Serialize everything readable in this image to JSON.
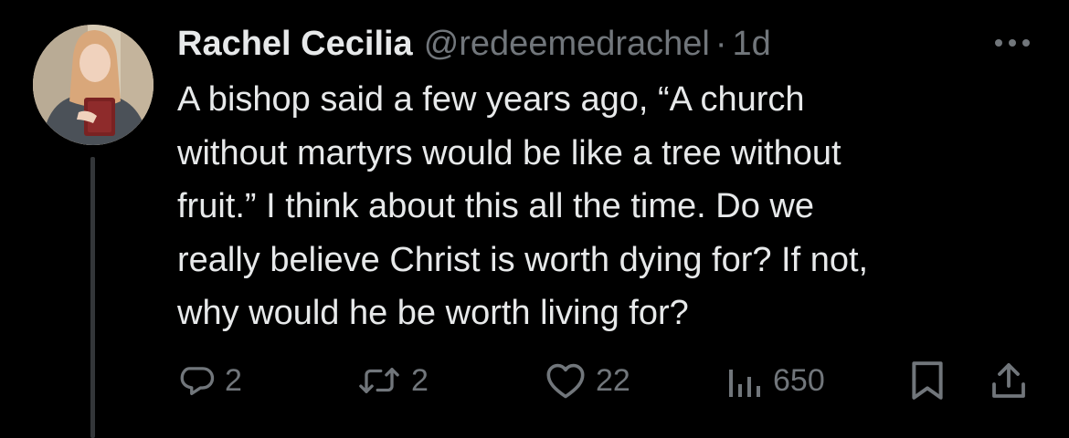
{
  "post": {
    "author_name": "Rachel Cecilia",
    "author_handle": "@redeemedrachel",
    "separator": "·",
    "time_ago": "1d",
    "text": "A bishop said a few years ago, “A church\nwithout martyrs would be like a tree without\nfruit.” I think about this all the time. Do we\nreally believe Christ is worth dying for? If not,\nwhy would he be worth living for?"
  },
  "actions": {
    "replies": "2",
    "reposts": "2",
    "likes": "22",
    "views": "650"
  },
  "icons": {
    "avatar": "avatar-photo",
    "more": "more-horizontal-icon",
    "reply": "reply-icon",
    "repost": "repost-icon",
    "like": "heart-icon",
    "views": "views-icon",
    "bookmark": "bookmark-icon",
    "share": "share-icon"
  },
  "colors": {
    "background": "#000000",
    "primary_text": "#e7e9ea",
    "secondary_text": "#71767b",
    "thread_line": "#333639"
  }
}
